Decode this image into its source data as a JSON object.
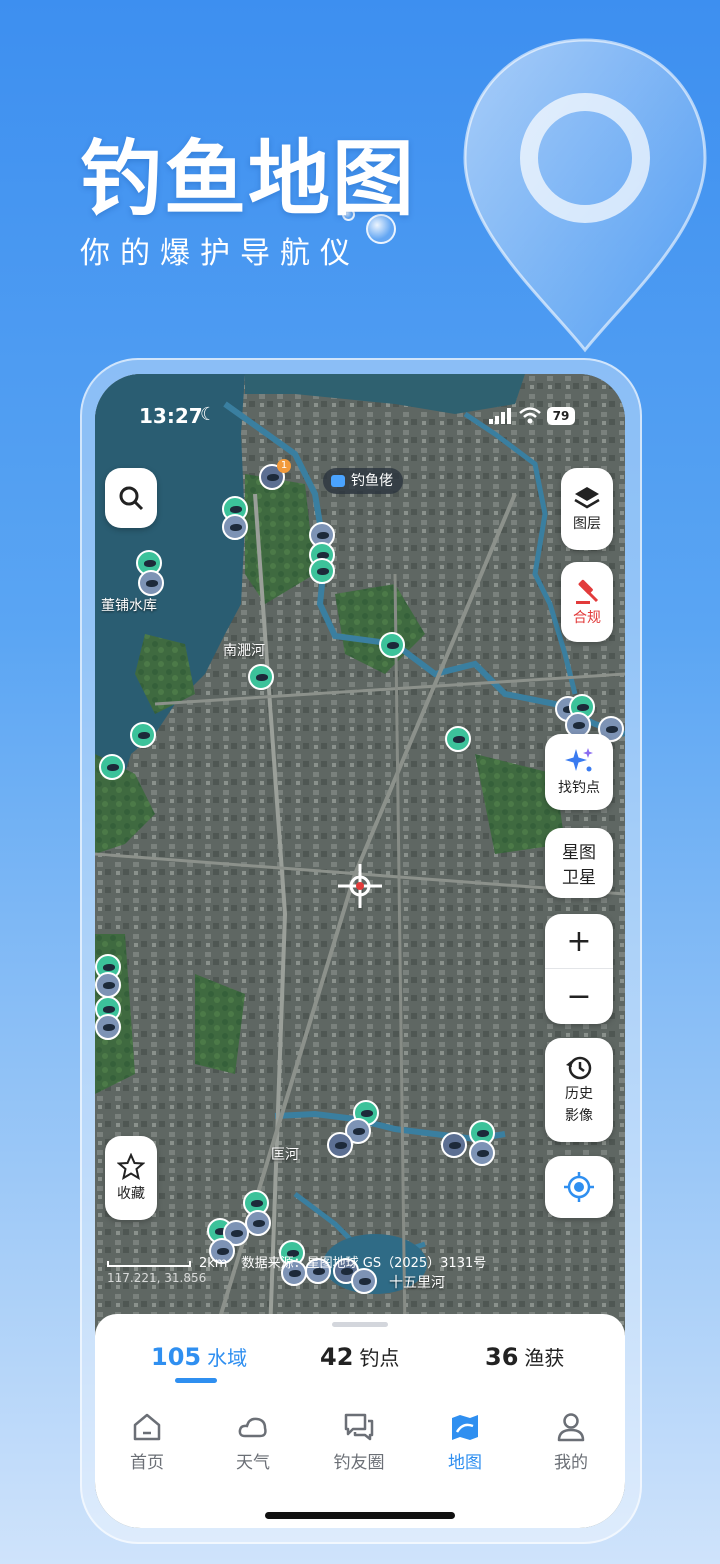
{
  "promo": {
    "headline": "钓鱼地图",
    "subline": "你的爆护导航仪"
  },
  "status_bar": {
    "time": "13:27",
    "battery": "79"
  },
  "map": {
    "spot_chip": "钓鱼佬",
    "labels": {
      "reservoir": "董铺水库",
      "river_nanfei": "南淝河",
      "river_kuang": "匡河",
      "river_shiwuli": "十五里河"
    },
    "marker_badge": "1",
    "scale_text": "2km",
    "attribution": "数据来源：星图地球 GS（2025）3131号",
    "coordinates": "117.221, 31.856"
  },
  "controls": {
    "search": "search",
    "layers": "图层",
    "compliance": "合规",
    "find_spot": "找钓点",
    "satellite_line1": "星图",
    "satellite_line2": "卫星",
    "zoom_in": "+",
    "zoom_out": "−",
    "history_line1": "历史",
    "history_line2": "影像",
    "favorite": "收藏"
  },
  "stats": [
    {
      "value": "105",
      "unit": "水域"
    },
    {
      "value": "42",
      "unit": "钓点"
    },
    {
      "value": "36",
      "unit": "渔获"
    }
  ],
  "tabs": [
    {
      "label": "首页"
    },
    {
      "label": "天气"
    },
    {
      "label": "钓友圈"
    },
    {
      "label": "地图"
    },
    {
      "label": "我的"
    }
  ],
  "colors": {
    "accent": "#2f8ff0",
    "compliance_red": "#e23b3b",
    "marker_green": "#3cc29a"
  }
}
